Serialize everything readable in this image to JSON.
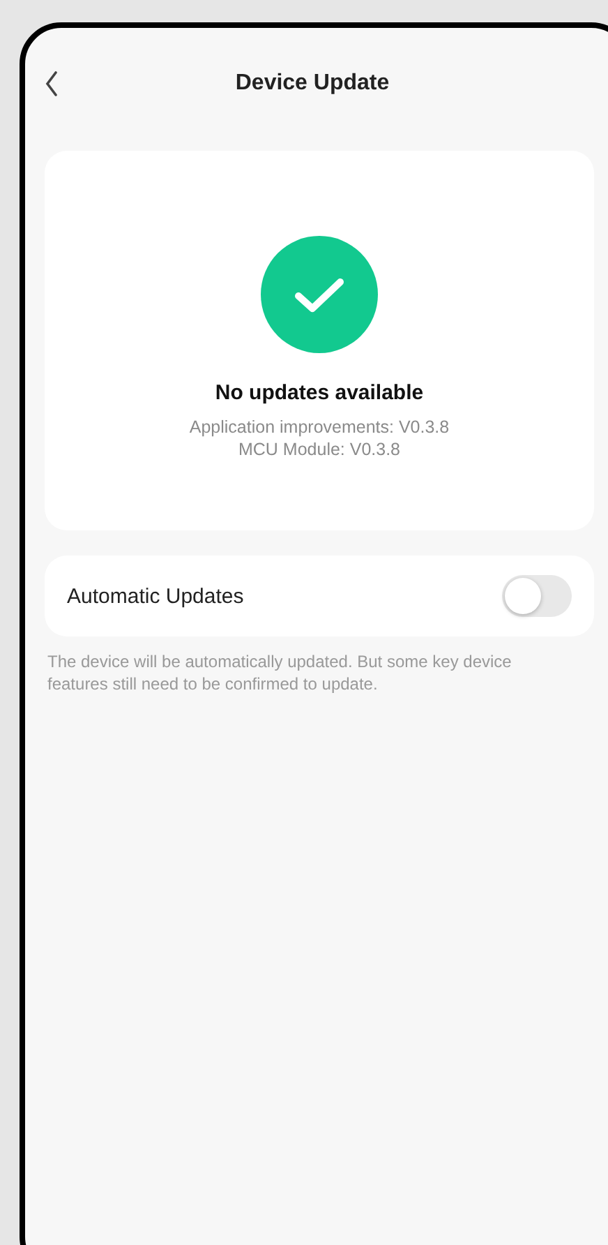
{
  "header": {
    "title": "Device Update"
  },
  "status": {
    "kind": "ok",
    "headline": "No updates available",
    "versions": [
      "Application improvements: V0.3.8",
      "MCU Module: V0.3.8"
    ]
  },
  "auto_update": {
    "label": "Automatic Updates",
    "on": false,
    "note": "The device will be automatically updated. But some key device features still need to be confirmed to update."
  }
}
